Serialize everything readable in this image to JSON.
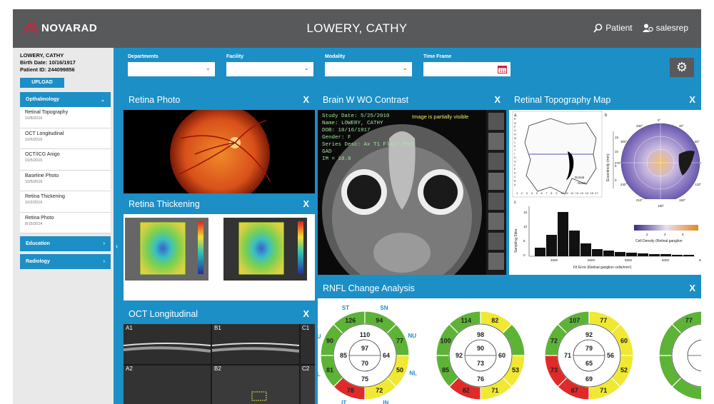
{
  "brand": {
    "name": "NOVARAD"
  },
  "header": {
    "patient_name": "LOWERY, CATHY",
    "patient_link": "Patient",
    "user": "salesrep"
  },
  "patient_info": {
    "name": "LOWERY, CATHY",
    "birth": "Birth Date: 10/16/1917",
    "id": "Patient ID: 244099856"
  },
  "sidebar": {
    "upload_label": "UPLOAD",
    "active_section": "Opthalmology",
    "studies": [
      {
        "name": "Retinal Topography",
        "date": "10/8/2016"
      },
      {
        "name": "OCT Longitudinal",
        "date": "10/6/2016"
      },
      {
        "name": "OCT/ICG Anigo",
        "date": "10/5/2016"
      },
      {
        "name": "Baseline Photo",
        "date": "10/5/2016"
      },
      {
        "name": "Retina Thickening",
        "date": "10/2/2016"
      },
      {
        "name": "Retina Photo",
        "date": "8/15/2014"
      }
    ],
    "other_sections": [
      "Education",
      "Radiology"
    ]
  },
  "filters": {
    "labels": [
      "Departments",
      "Facility",
      "Modality",
      "Time Frame"
    ]
  },
  "panels": {
    "retina_photo": {
      "title": "Retina Photo"
    },
    "retina_thickening": {
      "title": "Retina Thickening"
    },
    "oct_longitudinal": {
      "title": "OCT Longitudinal",
      "labels": [
        "A1",
        "B1",
        "C1",
        "A2",
        "B2",
        "C2"
      ]
    },
    "brain": {
      "title": "Brain W WO Contrast",
      "overlay": [
        "Study Date: 5/25/2010",
        "Name: LOWERY, CATHY",
        "DOB: 10/16/1917",
        "Gender: F",
        "Series Desc: Ax T1 Flair Post",
        "GAD",
        "IM = 10.0"
      ],
      "notice": "Image is partially visible"
    },
    "topography": {
      "title": "Retinal Topography Map",
      "panel_letters": [
        "a",
        "b",
        "c"
      ],
      "axis_text": {
        "nasal": "Nasal",
        "dorsal": "Dorsal",
        "ecc": "Eccentricity (mm)",
        "sites": "Sampling Sites",
        "fit": "Fit Error (Retinal ganglion cells/mm²)",
        "density": "Cell Density (Retinal ganglion"
      },
      "grid_ticks": [
        "1",
        "2",
        "3",
        "4",
        "5",
        "6",
        "7",
        "8",
        "9",
        "10",
        "11",
        "12",
        "13",
        "14",
        "15",
        "16",
        "17"
      ],
      "side_ticks": [
        "R",
        "Q",
        "P",
        "O",
        "N",
        "M",
        "L",
        "K",
        "J",
        "I",
        "H",
        "G",
        "F",
        "E",
        "D",
        "C",
        "B",
        "A"
      ],
      "polar_angles": [
        "0°",
        "30°",
        "60°",
        "90°",
        "120°",
        "150°",
        "180°",
        "210°",
        "240°",
        "270°",
        "300°",
        "330°"
      ],
      "ecc_ticks": [
        "15",
        "10",
        "5",
        "0"
      ],
      "hist_y": [
        "15",
        "10",
        "5",
        "0"
      ],
      "hist_x": [
        "4500",
        "5000",
        "5500",
        "6000",
        "6500"
      ],
      "density_ticks": [
        "2",
        "4",
        "6"
      ]
    },
    "rnfl": {
      "title": "RNFL Change Analysis",
      "labels": [
        "ST",
        "SN",
        "NU",
        "NL",
        "IN",
        "IT",
        "TL",
        "TU"
      ]
    }
  },
  "chart_data": {
    "type": "table",
    "title": "RNFL Change Analysis",
    "columns": [
      "outer_ST",
      "outer_SN",
      "outer_NU",
      "outer_NL",
      "outer_IN",
      "outer_IT",
      "outer_TL",
      "outer_TU",
      "mid_top",
      "mid_right",
      "mid_bottom",
      "mid_left",
      "inner_top",
      "inner_bottom"
    ],
    "rows": [
      [
        126,
        94,
        77,
        50,
        72,
        78,
        81,
        90,
        110,
        64,
        75,
        85,
        97,
        70
      ],
      [
        114,
        82,
        null,
        53,
        71,
        82,
        85,
        100,
        98,
        60,
        76,
        92,
        90,
        73
      ],
      [
        107,
        77,
        60,
        52,
        71,
        67,
        73,
        72,
        92,
        56,
        69,
        71,
        79,
        65
      ],
      [
        77,
        null,
        null,
        null,
        null,
        null,
        null,
        null,
        null,
        null,
        null,
        null,
        null,
        null
      ]
    ],
    "colors": [
      "green",
      "yellow",
      "red"
    ]
  },
  "theme": {
    "accent": "#1c8fc6",
    "topbar": "#58595b",
    "green": "#5cb336",
    "yellow": "#f0e832",
    "red": "#e02a2a"
  }
}
